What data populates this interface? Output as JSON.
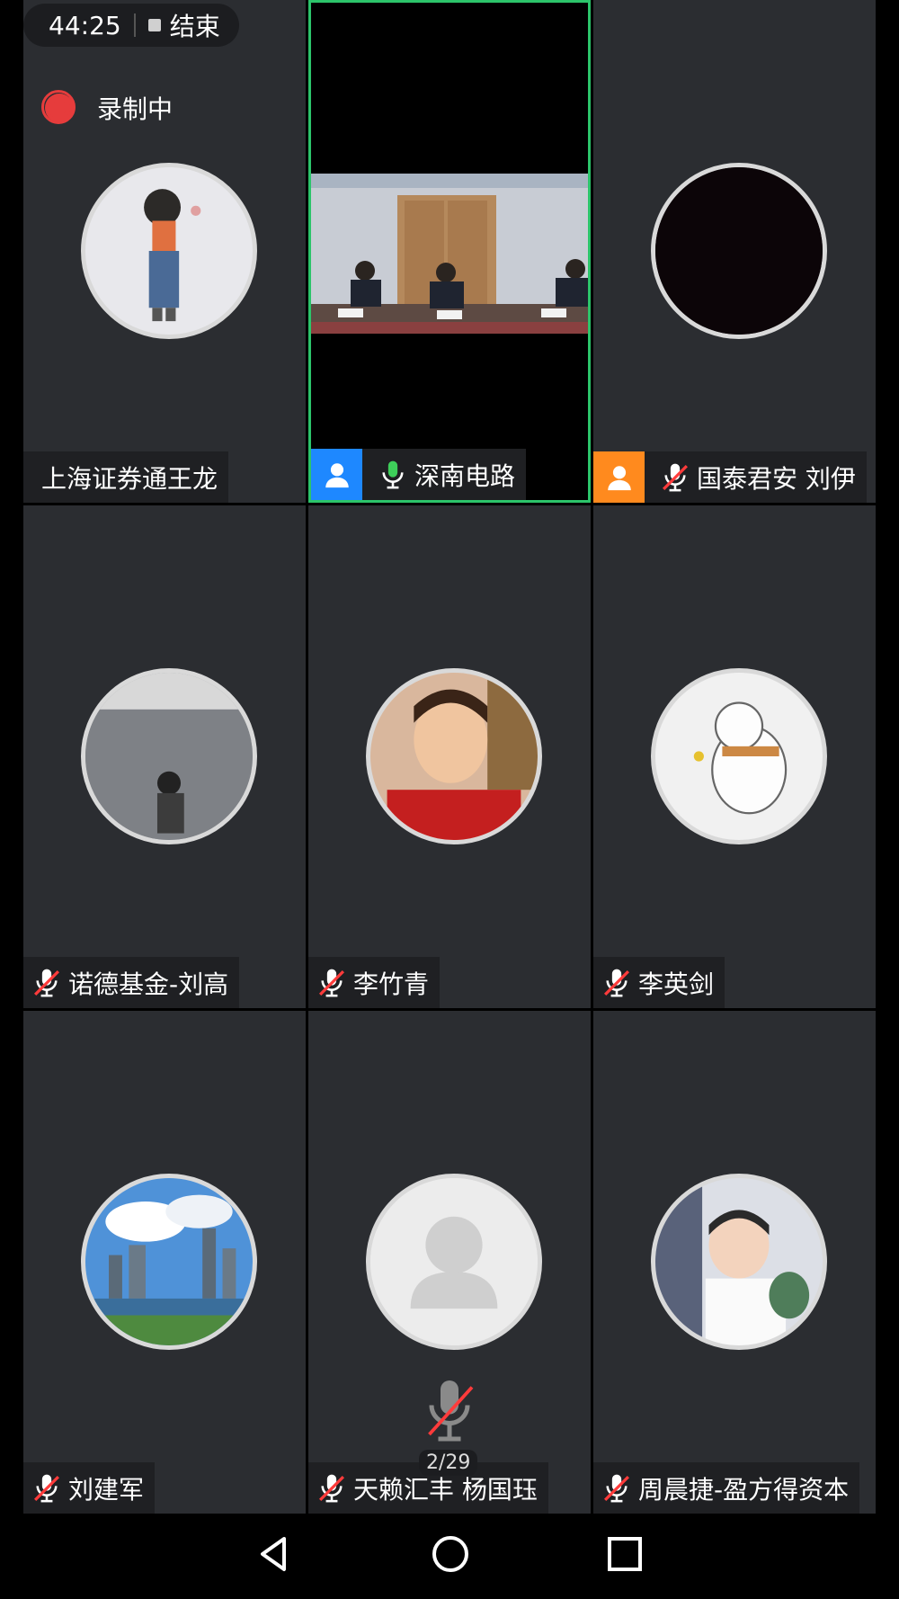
{
  "status": {
    "timer": "44:25",
    "end_label": "结束",
    "recording_label": "录制中"
  },
  "tiles": [
    {
      "name": "上海证券通王龙"
    },
    {
      "name": "深南电路"
    },
    {
      "name": "国泰君安 刘伊"
    },
    {
      "name": "诺德基金-刘高"
    },
    {
      "name": "李竹青"
    },
    {
      "name": "李英剑"
    },
    {
      "name": "刘建军"
    },
    {
      "name": "天赖汇丰  杨国珏"
    },
    {
      "name": "周晨捷-盈方得资本"
    }
  ],
  "page_indicator": "2/29",
  "colors": {
    "active_border": "#2cc46a",
    "host_badge": "#1e88ff",
    "cohost_badge": "#ff8a1e",
    "record_red": "#e63c3c",
    "mic_on": "#3ecf5a",
    "mute_slash": "#ff3b3b"
  },
  "icons": [
    "mic-muted-icon",
    "mic-on-icon",
    "user-icon",
    "back-icon",
    "home-icon",
    "recents-icon"
  ]
}
